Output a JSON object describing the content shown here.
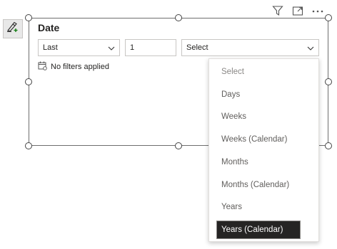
{
  "slicer": {
    "title": "Date",
    "relative_label": "Last",
    "count_value": "1",
    "unit_value": "Select",
    "filter_status": "No filters applied"
  },
  "menu": {
    "items": [
      {
        "label": "Select",
        "placeholder": true
      },
      {
        "label": "Days"
      },
      {
        "label": "Weeks"
      },
      {
        "label": "Weeks (Calendar)"
      },
      {
        "label": "Months"
      },
      {
        "label": "Months (Calendar)"
      },
      {
        "label": "Years"
      },
      {
        "label": "Years (Calendar)",
        "selected": true
      }
    ]
  },
  "icons": {
    "format_painter": "format-painter-icon",
    "filter": "filter-icon",
    "focus_mode": "focus-mode-icon",
    "more_options": "more-options-icon",
    "filter_status": "calendar-filter-icon"
  },
  "colors": {
    "selected_bg": "#252423",
    "selected_fg": "#ffffff",
    "menu_text": "#605e5c",
    "frame_border": "#6e6e6e"
  }
}
